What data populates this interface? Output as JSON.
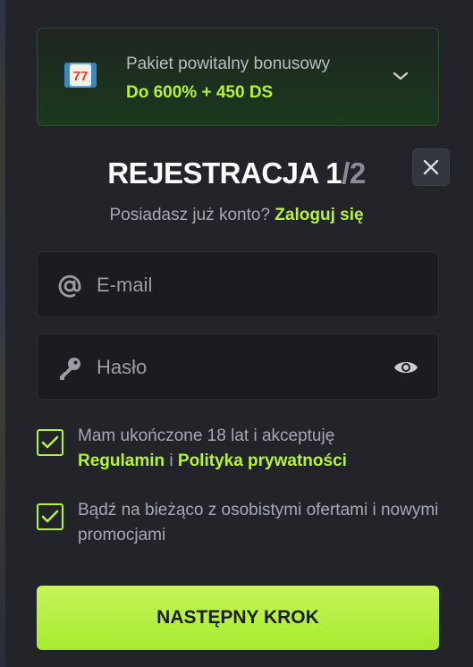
{
  "bonus": {
    "icon": "slot-77-icon",
    "title": "Pakiet powitalny bonusowy",
    "value": "Do 600% + 450 DS",
    "icon_text": "77"
  },
  "header": {
    "title_main": "REJESTRACJA 1",
    "title_step": "/2",
    "close_icon": "close-icon"
  },
  "login": {
    "prompt": "Posiadasz już konto?",
    "link": "Zaloguj się"
  },
  "form": {
    "email_placeholder": "E-mail",
    "password_placeholder": "Hasło"
  },
  "consents": [
    {
      "checked": true,
      "text_before": "Mam ukończone 18 lat i akceptuję",
      "link1": "Regulamin",
      "joiner": " i ",
      "link2": "Polityka prywatności"
    },
    {
      "checked": true,
      "text": "Bądź na bieżąco z osobistymi ofertami i nowymi promocjami"
    }
  ],
  "actions": {
    "next_label": "NASTĘPNY KROK"
  },
  "colors": {
    "accent": "#b6f23c",
    "background": "#23242a",
    "field": "#1b1c20"
  }
}
